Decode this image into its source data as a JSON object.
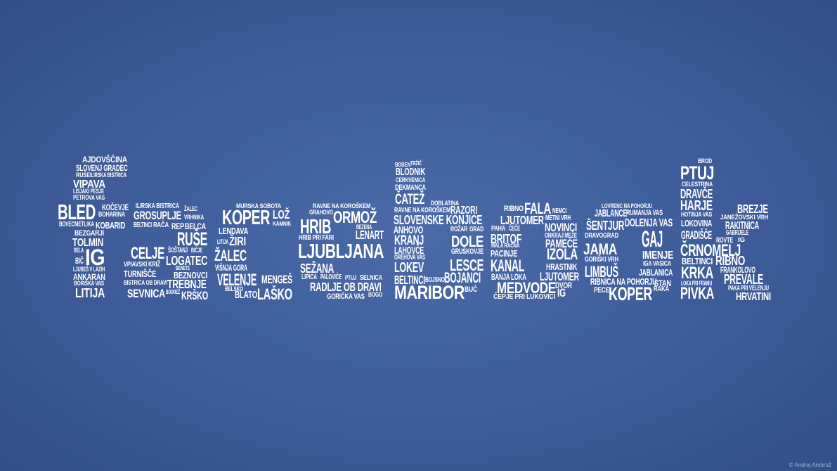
{
  "background_color": "#3f5e9c",
  "text_color": "#ffffff",
  "credit": "© Andrej Ambrož",
  "words": [
    "AJDOVŠČINA",
    "SLOVENJ GRADEC",
    "RUŠE",
    "ILIRSKA BISTRICA",
    "VIPAVA",
    "LISJAKI PESJE",
    "PETROVA VAS",
    "BLED",
    "KOČEVJE",
    "BOHARINA",
    "BOVEC",
    "METLIKA",
    "KOBARID",
    "BEZGARJI",
    "TOLMIN",
    "BELA",
    "BIČ",
    "IG",
    "LJUBEŠ V LAZIH",
    "ANKARAN",
    "BORIŠKA VAS",
    "LITIJA",
    "ILIRSKA BISTRICA",
    "ŽALEC",
    "GROSUPLJE",
    "VRHNIKA",
    "BELTINCI",
    "RAČA",
    "REP",
    "BELCA",
    "RUŠE",
    "CELJE",
    "ŠOŠTANJ",
    "BIČJE",
    "LOGATEC",
    "VPIAVSKI KRIŽ",
    "TURNIŠČE",
    "BENETE",
    "BEZNOVCI",
    "BISTRICA OB DRAVI",
    "TREBNJE",
    "SEVNICA",
    "BODREŽ",
    "KRŠKO",
    "MURSKA SOBOTA",
    "KOPER",
    "LOŽ",
    "KAMNIK",
    "LENDAVA",
    "LITIJA",
    "ŽIRI",
    "ŽALEC",
    "VIŠNJA GORA",
    "VELENJE",
    "MENGEŠ",
    "BELSKO",
    "BLATO",
    "LAŠKO",
    "RAVNE NA KOROŠKEM",
    "GRAHOVO",
    "HRIB",
    "ORMOŽ",
    "BEZENA",
    "LENART",
    "HRIB PRI FARI",
    "LJUBLJANA",
    "SEŽANA",
    "LIPICA",
    "PALOVIČE",
    "PTUJ",
    "SELNICA",
    "RADLJE OB DRAVI",
    "GORIČKA VAS",
    "BOGO",
    "BOBEN",
    "TRŽIČ",
    "BLODNIK",
    "CERKVENICA",
    "DEKMANCA",
    "ČATEŽ",
    "DOBLATINA",
    "RAVNE NA KOROŠKEM",
    "RAZORI",
    "SLOVENSKE KONJICE",
    "ANHOVO",
    "ROŽAR",
    "GRAD",
    "KRANJ",
    "DOLE",
    "LAHOVČE",
    "GRUŠKOVJE",
    "OREHOVA VAS",
    "LOKEV",
    "LESCE",
    "BELTINCI",
    "BOJSNO",
    "BOJANCI",
    "MARIBOR",
    "BUČ",
    "RIBNO",
    "FALA",
    "NEMCI",
    "LJUTOMER",
    "METNI VRH",
    "PAHA",
    "ČEČE",
    "NOVINCI",
    "BRITOF",
    "ONKRAJ MEŽE",
    "MALA RAČNA",
    "PAMEČE",
    "PACINJE",
    "IZOLA",
    "KANAL",
    "HRASTNIK",
    "BANJA LOKA",
    "LJUTOMER",
    "MEDVODE",
    "DVOR",
    "IG",
    "ČEPJE PRI LUKOVICI",
    "LOVRENC NA POHORJU",
    "JABLANCE",
    "RUMANJA VAS",
    "ŠENTJUR",
    "DOLENJA VAS",
    "DRAVOGRAD",
    "GAJ",
    "JAMA",
    "IMENJE",
    "GORIŠKI VRH",
    "IGA VASICA",
    "LIMBUŠ",
    "JABLANICA",
    "RIBNICA NA POHORJU",
    "PECE",
    "KOPER",
    "STAN",
    "RAKA",
    "BROD",
    "PTUJ",
    "CELESTRINA",
    "DRAVČE",
    "HARJE",
    "BREZJE",
    "HOTINJA VAS",
    "JANEŽOVSKI VRH",
    "LOKOVINA",
    "RAKITNICA",
    "GRADIŠČE",
    "GABRIJELE",
    "ROVTE",
    "IG",
    "ČRNOMELJ",
    "BELTINCI",
    "RIBNO",
    "KRKA",
    "FRANKOLOVO",
    "LOKA PRI FRAMU",
    "PREVALE",
    "PAKA PRI VELENJU",
    "PIVKA",
    "HRVATINI"
  ]
}
